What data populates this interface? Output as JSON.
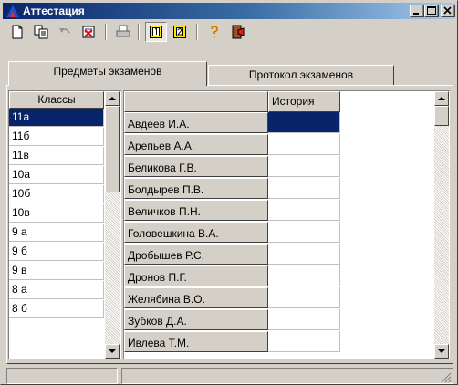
{
  "window": {
    "title": "Аттестация"
  },
  "toolbar": {
    "buttons": [
      {
        "name": "new-document-icon"
      },
      {
        "name": "copy-document-icon"
      },
      {
        "name": "undo-icon"
      },
      {
        "name": "delete-icon"
      },
      {
        "name": "print-icon"
      },
      {
        "name": "view-one-icon"
      },
      {
        "name": "view-two-icon"
      },
      {
        "name": "help-icon"
      },
      {
        "name": "exit-icon"
      }
    ]
  },
  "tabs": [
    {
      "label": "Предметы экзаменов",
      "active": true
    },
    {
      "label": "Протокол экзаменов",
      "active": false
    }
  ],
  "classes": {
    "header": "Классы",
    "items": [
      "11а",
      "11б",
      "11в",
      "10а",
      "10б",
      "10в",
      "9 а",
      "9 б",
      "9 в",
      "8 а",
      "8 б"
    ],
    "selected_index": 0
  },
  "students": {
    "column_header": "История",
    "names": [
      "Авдеев И.А.",
      "Арепьев А.А.",
      "Беликова Г.В.",
      "Болдырев П.В.",
      "Величков П.Н.",
      "Головешкина В.А.",
      "Дробышев Р.С.",
      "Дронов П.Г.",
      "Желябина В.О.",
      "Зубков Д.А.",
      "Ивлева Т.М."
    ],
    "selected_index": 0
  },
  "colors": {
    "selection": "#0a246a",
    "face": "#d4d0c8",
    "title_start": "#0a246a"
  }
}
